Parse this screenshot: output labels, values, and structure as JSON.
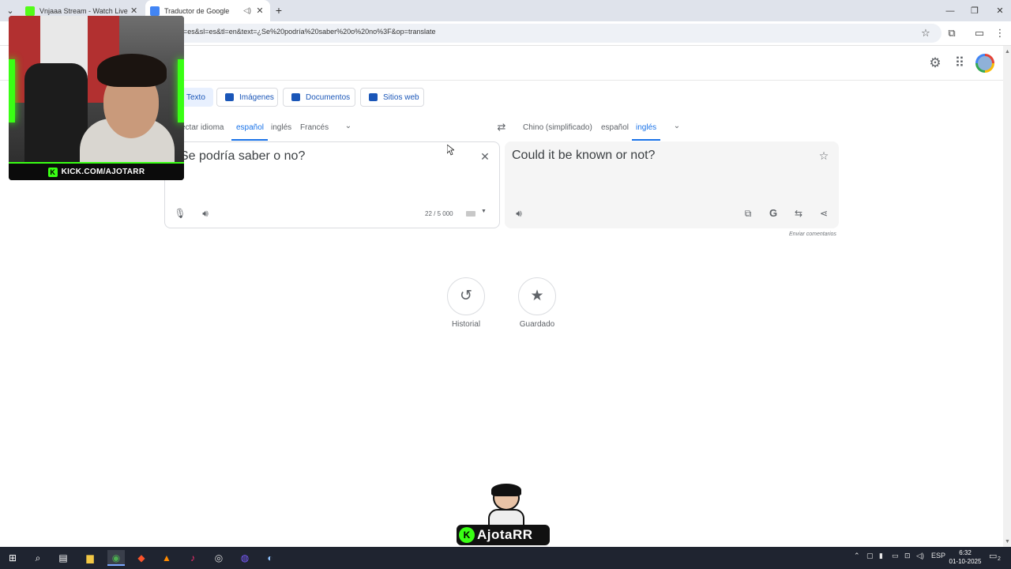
{
  "browser": {
    "tabs": [
      {
        "title": "Vnjaaa Stream - Watch Live on",
        "active": false,
        "favicon_color": "#53fc18"
      },
      {
        "title": "Traductor de Google",
        "active": true,
        "favicon_color": "#4285f4"
      }
    ],
    "url": "=es&sl=es&tl=en&text=¿Se%20podría%20saber%20o%20no%3F&op=translate"
  },
  "translate": {
    "modes": [
      {
        "label": "Texto",
        "active": true
      },
      {
        "label": "Imágenes",
        "active": false
      },
      {
        "label": "Documentos",
        "active": false
      },
      {
        "label": "Sitios web",
        "active": false
      }
    ],
    "source_langs": [
      "ectar idioma",
      "español",
      "inglés",
      "Francés"
    ],
    "source_selected": "español",
    "target_langs": [
      "Chino (simplificado)",
      "español",
      "inglés"
    ],
    "target_selected": "inglés",
    "source_text": "Se podría saber o no?",
    "translated_text": "Could it be known or not?",
    "char_count": "22 / 5 000",
    "feedback": "Enviar comentarios",
    "history_label": "Historial",
    "saved_label": "Guardado"
  },
  "overlay": {
    "webcam_caption": "KICK.COM/AJOTARR",
    "logo_text": "AjotaRR",
    "logo_badge": "K"
  },
  "taskbar": {
    "language": "ESP",
    "time": "6:32",
    "date": "01-10-2025",
    "notification_count": "2"
  },
  "colors": {
    "accent": "#1a73e8",
    "kick_green": "#39ff14"
  }
}
